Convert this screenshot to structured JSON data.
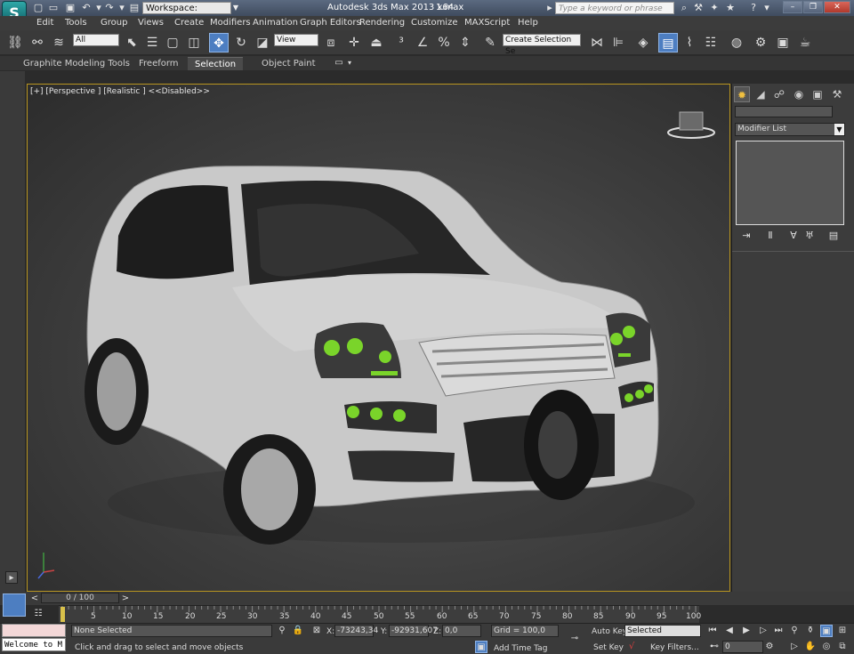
{
  "window": {
    "app_title": "Autodesk 3ds Max  2013 x64",
    "file_name": "1.max",
    "workspace_label": "Workspace: Default",
    "search_placeholder": "Type a keyword or phrase",
    "logo_letter": "S"
  },
  "menu": {
    "items": [
      "Edit",
      "Tools",
      "Group",
      "Views",
      "Create",
      "Modifiers",
      "Animation",
      "Graph Editors",
      "Rendering",
      "Customize",
      "MAXScript",
      "Help"
    ]
  },
  "toolbar": {
    "selection_filter": "All",
    "reference_coord": "View",
    "named_selection": "Create Selection Se"
  },
  "ribbon": {
    "tabs": [
      "Graphite Modeling Tools",
      "Freeform",
      "Selection",
      "Object Paint"
    ],
    "selected_tab": "Selection"
  },
  "viewport": {
    "label": "[+] [Perspective ] [Realistic ]  <<Disabled>>",
    "border_color": "#b89520",
    "object_color": "#c9c9c9",
    "light_color": "#7ad42a"
  },
  "command_panel": {
    "modifier_list_label": "Modifier List"
  },
  "timeline": {
    "slider_label": "0 / 100",
    "ticks": [
      "5",
      "10",
      "15",
      "20",
      "25",
      "30",
      "35",
      "40",
      "45",
      "50",
      "55",
      "60",
      "65",
      "70",
      "75",
      "80",
      "85",
      "90",
      "95",
      "100"
    ]
  },
  "status": {
    "listener_text": "Welcome to M",
    "selection_status": "None Selected",
    "prompt": "Click and drag to select and move objects",
    "x_label": "X:",
    "x_value": "-73243,34",
    "y_label": "Y:",
    "y_value": "-92931,607",
    "z_label": "Z:",
    "z_value": "0,0",
    "grid": "Grid = 100,0",
    "add_time_tag": "Add Time Tag",
    "auto_key": "Auto Key",
    "set_key": "Set Key",
    "key_mode": "Selected",
    "key_filters": "Key Filters...",
    "frame_value": "0"
  }
}
